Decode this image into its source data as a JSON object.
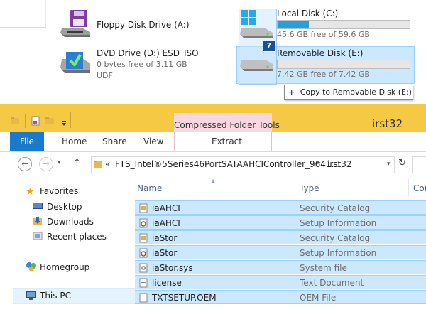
{
  "drives": {
    "floppy": {
      "label": "Floppy Disk Drive (A:)"
    },
    "dvd": {
      "label": "DVD Drive (D:) ESD_ISO",
      "free": "0 bytes free of 3.11 GB",
      "fs": "UDF"
    },
    "local": {
      "label": "Local Disk (C:)",
      "free": "45.6 GB free of 59.6 GB",
      "used_fraction": 0.235
    },
    "removable": {
      "label": "Removable Disk (E:)",
      "free": "7.42 GB free of 7.42 GB",
      "used_fraction": 0.0
    }
  },
  "drag": {
    "count": "7",
    "tooltip_plus": "+",
    "tooltip": "Copy to Removable Disk (E:)"
  },
  "titlebar": {
    "context_group": "Compressed Folder Tools",
    "window_title": "irst32"
  },
  "ribbon": {
    "file": "File",
    "home": "Home",
    "share": "Share",
    "view": "View",
    "extract": "Extract"
  },
  "address": {
    "prefix": "«",
    "path1": "FTS_Intel®5Series46PortSATAAHCIController_9641...",
    "path2": "irst32"
  },
  "nav": {
    "favorites": "Favorites",
    "desktop": "Desktop",
    "downloads": "Downloads",
    "recent": "Recent places",
    "homegroup": "Homegroup",
    "thispc": "This PC"
  },
  "columns": {
    "name": "Name",
    "type": "Type",
    "third": "Cor"
  },
  "files": [
    {
      "name": "iaAHCI",
      "type": "Security Catalog",
      "icon": "catalog-icon"
    },
    {
      "name": "iaAHCI",
      "type": "Setup Information",
      "icon": "setup-info-icon"
    },
    {
      "name": "iaStor",
      "type": "Security Catalog",
      "icon": "catalog-icon"
    },
    {
      "name": "iaStor",
      "type": "Setup Information",
      "icon": "setup-info-icon"
    },
    {
      "name": "iaStor.sys",
      "type": "System file",
      "icon": "system-file-icon"
    },
    {
      "name": "license",
      "type": "Text Document",
      "icon": "text-file-icon"
    },
    {
      "name": "TXTSETUP.OEM",
      "type": "OEM File",
      "icon": "blank-file-icon"
    }
  ],
  "colors": {
    "titlebar": "#f6c944",
    "selection": "#cce8ff",
    "accent": "#1979ca"
  }
}
